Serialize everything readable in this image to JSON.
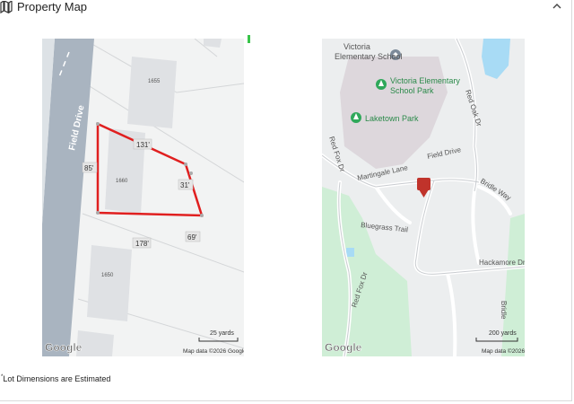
{
  "header": {
    "title": "Property Map",
    "icon": "map-book-icon",
    "toggle_icon": "chevron-up-icon"
  },
  "lot_map": {
    "lots": [
      "1655",
      "1660",
      "1650"
    ],
    "street": "Field Drive",
    "dimensions": [
      "131'",
      "85'",
      "31'",
      "69'",
      "178'"
    ],
    "scale_label": "25 yards",
    "attribution": "Map data ©2026 Google",
    "logo": "Google"
  },
  "area_map": {
    "places": [
      "Victoria Elementary School",
      "Victoria Elementary School Park",
      "Laketown Park"
    ],
    "streets": [
      "Red Oak Dr",
      "Field Drive",
      "Martingale Lane",
      "Bridle Way",
      "Red Fox Dr",
      "Bluegrass Trail",
      "Hackamore Dr",
      "Bridle",
      "Red Fox Dr"
    ],
    "scale_label": "200 yards",
    "attribution": "Map data ©2026",
    "logo": "Google"
  },
  "footnote": {
    "marker": "*",
    "text": "Lot Dimensions are Estimated"
  }
}
